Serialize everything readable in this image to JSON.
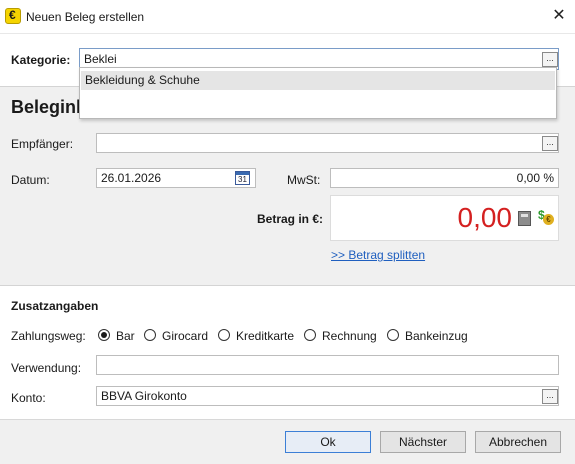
{
  "window": {
    "title": "Neuen Beleg erstellen",
    "close_glyph": "✕",
    "app_icon_glyph": "€"
  },
  "kategorie": {
    "label": "Kategorie:",
    "value": "Beklei",
    "dots": "...",
    "suggestions": [
      "Bekleidung & Schuhe"
    ]
  },
  "section_title": "Beleginl",
  "empfaenger": {
    "label": "Empfänger:",
    "value": "",
    "dots": "..."
  },
  "datum": {
    "label": "Datum:",
    "value": "26.01.2026",
    "calendar_day": "31"
  },
  "mwst": {
    "label": "MwSt:",
    "value": "0,00 %"
  },
  "betrag": {
    "label": "Betrag in €:",
    "value": "0,00",
    "split_link": ">> Betrag splitten",
    "amount_color": "#d42020"
  },
  "zusatz": {
    "title": "Zusatzangaben",
    "zahlungsweg_label": "Zahlungsweg:",
    "options": [
      {
        "label": "Bar",
        "checked": true
      },
      {
        "label": "Girocard",
        "checked": false
      },
      {
        "label": "Kreditkarte",
        "checked": false
      },
      {
        "label": "Rechnung",
        "checked": false
      },
      {
        "label": "Bankeinzug",
        "checked": false
      }
    ],
    "verwendung_label": "Verwendung:",
    "verwendung_value": "",
    "konto_label": "Konto:",
    "konto_value": "BBVA Girokonto",
    "konto_dots": "..."
  },
  "buttons": {
    "ok": "Ok",
    "next": "Nächster",
    "cancel": "Abbrechen"
  }
}
